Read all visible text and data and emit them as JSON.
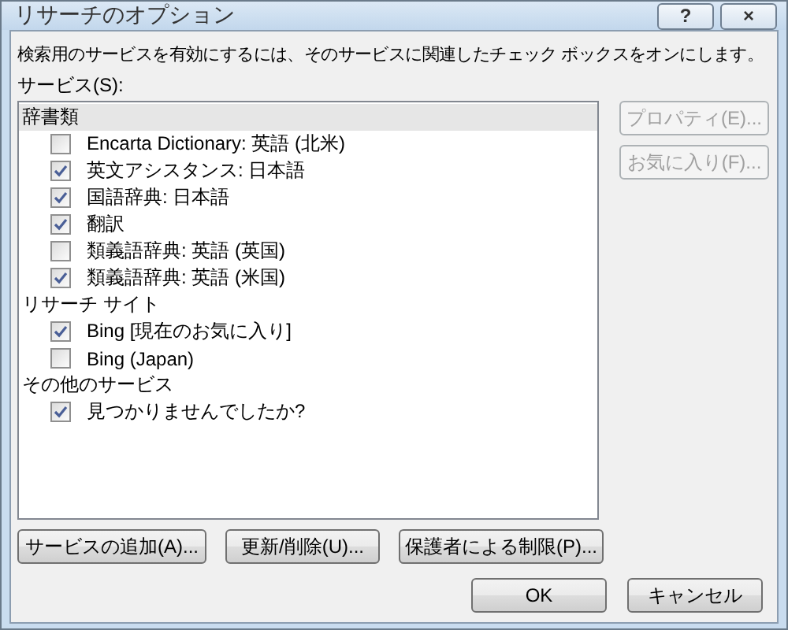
{
  "window": {
    "title": "リサーチのオプション",
    "title_buttons": [
      "?",
      "×"
    ]
  },
  "instruction": "検索用のサービスを有効にするには、そのサービスに関連したチェック ボックスをオンにします。",
  "services_label": "サービス(S):",
  "service_groups": [
    {
      "label": "辞書類",
      "selected": true,
      "items": [
        {
          "label": "Encarta Dictionary: 英語 (北米)",
          "checked": false
        },
        {
          "label": "英文アシスタンス: 日本語",
          "checked": true
        },
        {
          "label": "国語辞典: 日本語",
          "checked": true
        },
        {
          "label": "翻訳",
          "checked": true
        },
        {
          "label": "類義語辞典: 英語 (英国)",
          "checked": false
        },
        {
          "label": "類義語辞典: 英語 (米国)",
          "checked": true
        }
      ]
    },
    {
      "label": "リサーチ サイト",
      "selected": false,
      "items": [
        {
          "label": "Bing [現在のお気に入り]",
          "checked": true
        },
        {
          "label": "Bing (Japan)",
          "checked": false
        }
      ]
    },
    {
      "label": "その他のサービス",
      "selected": false,
      "items": [
        {
          "label": "見つかりませんでしたか?",
          "checked": true
        }
      ]
    }
  ],
  "side_buttons": [
    {
      "label": "プロパティ(E)...",
      "disabled": true
    },
    {
      "label": "お気に入り(F)...",
      "disabled": true
    }
  ],
  "bottom_buttons": [
    {
      "label": "サービスの追加(A)..."
    },
    {
      "label": "更新/削除(U)..."
    },
    {
      "label": "保護者による制限(P)..."
    }
  ],
  "dialog_buttons": [
    {
      "label": "OK"
    },
    {
      "label": "キャンセル"
    }
  ]
}
